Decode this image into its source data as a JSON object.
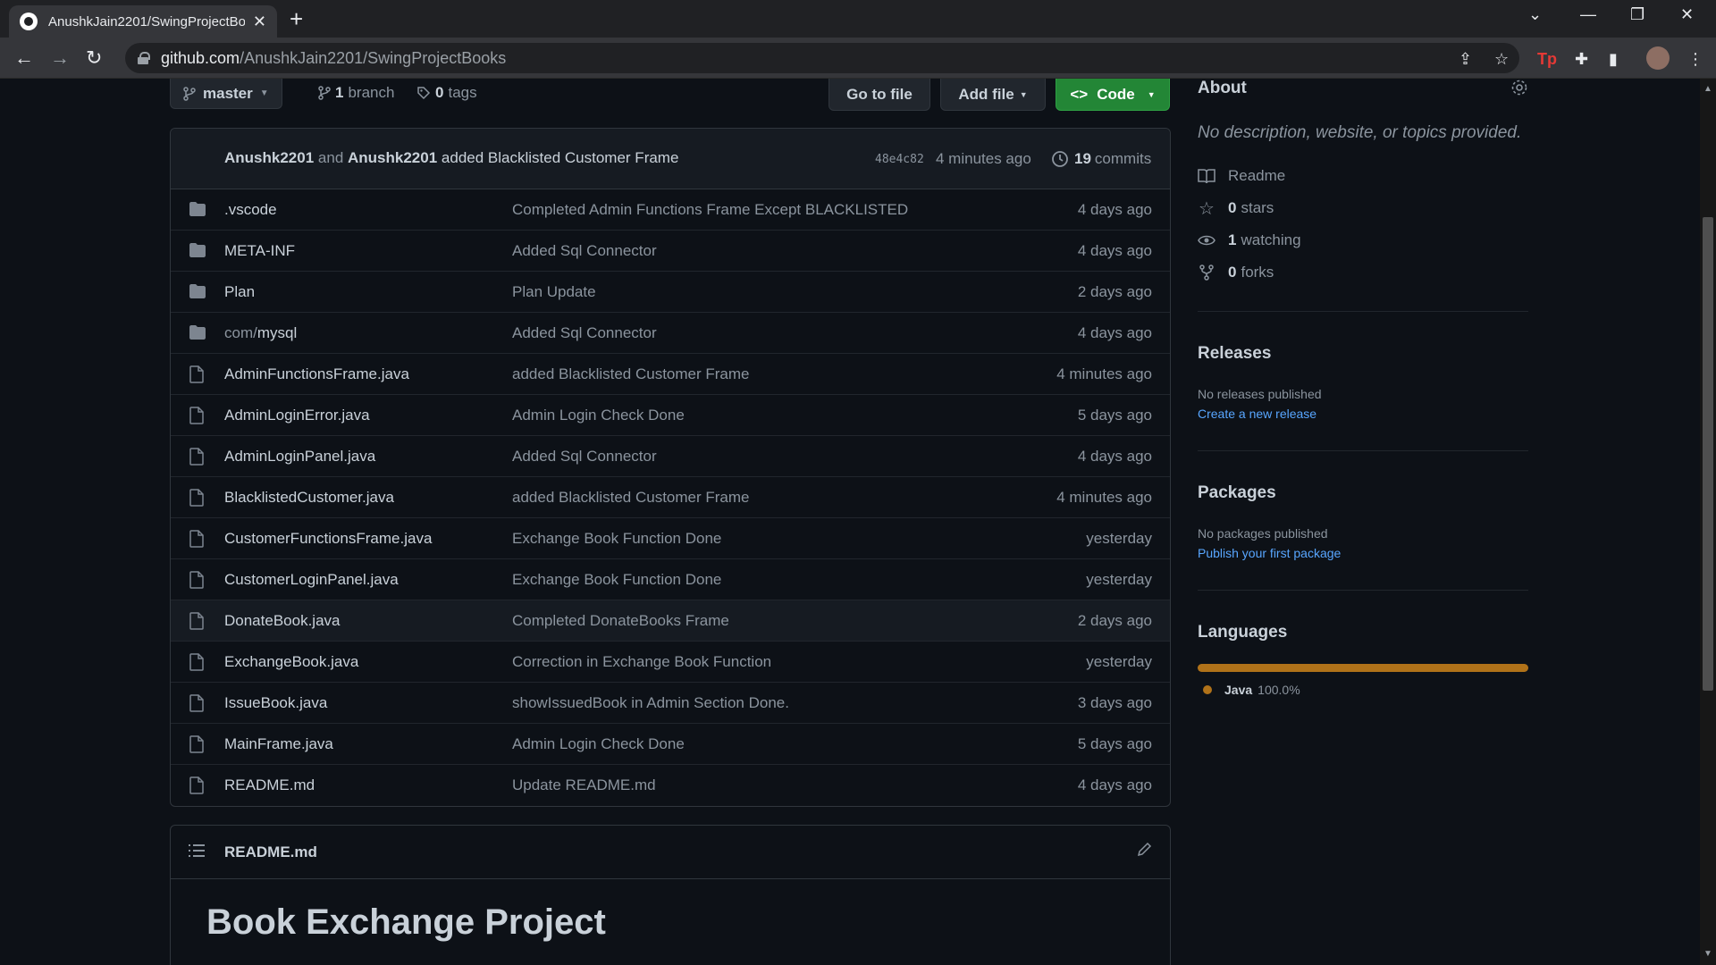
{
  "browser": {
    "tab_title": "AnushkJain2201/SwingProjectBo",
    "tab_close": "✕",
    "new_tab": "+",
    "url_host": "github.com",
    "url_path": "/AnushkJain2201/SwingProjectBooks"
  },
  "repo": {
    "branch": "master",
    "branch_count": "1",
    "branch_label": "branch",
    "tag_count": "0",
    "tag_label": "tags",
    "go_to_file": "Go to file",
    "add_file": "Add file",
    "code": "Code"
  },
  "latest_commit": {
    "author1": "Anushk2201",
    "and": "and",
    "author2": "Anushk2201",
    "message": "added Blacklisted Customer Frame",
    "sha": "48e4c82",
    "when": "4 minutes ago",
    "commit_count": "19",
    "commit_label": "commits"
  },
  "files": [
    {
      "type": "dir",
      "name": ".vscode",
      "prefix": "",
      "message": "Completed Admin Functions Frame Except BLACKLISTED",
      "age": "4 days ago"
    },
    {
      "type": "dir",
      "name": "META-INF",
      "prefix": "",
      "message": "Added Sql Connector",
      "age": "4 days ago"
    },
    {
      "type": "dir",
      "name": "Plan",
      "prefix": "",
      "message": "Plan Update",
      "age": "2 days ago"
    },
    {
      "type": "dir",
      "name": "mysql",
      "prefix": "com/",
      "message": "Added Sql Connector",
      "age": "4 days ago"
    },
    {
      "type": "file",
      "name": "AdminFunctionsFrame.java",
      "prefix": "",
      "message": "added Blacklisted Customer Frame",
      "age": "4 minutes ago"
    },
    {
      "type": "file",
      "name": "AdminLoginError.java",
      "prefix": "",
      "message": "Admin Login Check Done",
      "age": "5 days ago"
    },
    {
      "type": "file",
      "name": "AdminLoginPanel.java",
      "prefix": "",
      "message": "Added Sql Connector",
      "age": "4 days ago"
    },
    {
      "type": "file",
      "name": "BlacklistedCustomer.java",
      "prefix": "",
      "message": "added Blacklisted Customer Frame",
      "age": "4 minutes ago"
    },
    {
      "type": "file",
      "name": "CustomerFunctionsFrame.java",
      "prefix": "",
      "message": "Exchange Book Function Done",
      "age": "yesterday"
    },
    {
      "type": "file",
      "name": "CustomerLoginPanel.java",
      "prefix": "",
      "message": "Exchange Book Function Done",
      "age": "yesterday"
    },
    {
      "type": "file",
      "name": "DonateBook.java",
      "prefix": "",
      "message": "Completed DonateBooks Frame",
      "age": "2 days ago"
    },
    {
      "type": "file",
      "name": "ExchangeBook.java",
      "prefix": "",
      "message": "Correction in Exchange Book Function",
      "age": "yesterday"
    },
    {
      "type": "file",
      "name": "IssueBook.java",
      "prefix": "",
      "message": "showIssuedBook in Admin Section Done.",
      "age": "3 days ago"
    },
    {
      "type": "file",
      "name": "MainFrame.java",
      "prefix": "",
      "message": "Admin Login Check Done",
      "age": "5 days ago"
    },
    {
      "type": "file",
      "name": "README.md",
      "prefix": "",
      "message": "Update README.md",
      "age": "4 days ago"
    }
  ],
  "readme": {
    "filename": "README.md",
    "heading": "Book Exchange Project"
  },
  "about": {
    "title": "About",
    "description": "No description, website, or topics provided.",
    "readme": "Readme",
    "stars_count": "0",
    "stars_label": "stars",
    "watching_count": "1",
    "watching_label": "watching",
    "forks_count": "0",
    "forks_label": "forks"
  },
  "releases": {
    "title": "Releases",
    "none": "No releases published",
    "link": "Create a new release"
  },
  "packages": {
    "title": "Packages",
    "none": "No packages published",
    "link": "Publish your first package"
  },
  "languages": {
    "title": "Languages",
    "items": [
      {
        "name": "Java",
        "percent": "100.0%",
        "color": "#b07219"
      }
    ]
  },
  "colors": {
    "accent": "#238636",
    "link": "#58a6ff",
    "background": "#0d1117"
  }
}
